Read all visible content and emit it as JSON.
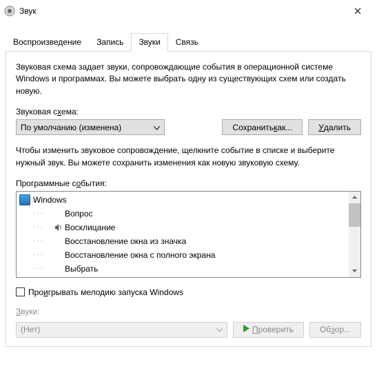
{
  "window": {
    "title": "Звук"
  },
  "tabs": [
    {
      "label": "Воспроизведение",
      "active": false
    },
    {
      "label": "Запись",
      "active": false
    },
    {
      "label": "Звуки",
      "active": true
    },
    {
      "label": "Связь",
      "active": false
    }
  ],
  "description": "Звуковая схема задает звуки, сопровождающие события в операционной системе Windows и программах. Вы можете выбрать одну из существующих схем или создать новую.",
  "scheme": {
    "label_pre": "Звуковая с",
    "label_acc": "х",
    "label_post": "ема:",
    "value": "По умолчанию (изменена)",
    "save_pre": "Сохранить ",
    "save_acc": "к",
    "save_post": "ак...",
    "delete_acc": "У",
    "delete_post": "далить"
  },
  "events_desc": "Чтобы изменить звуковое сопровождение, щелкните событие в списке и выберите нужный звук. Вы можете сохранить изменения как новую звуковую схему.",
  "events": {
    "label_pre": "Программные с",
    "label_acc": "о",
    "label_post": "бытия:",
    "root": "Windows",
    "items": [
      {
        "label": "Вопрос",
        "sound": false
      },
      {
        "label": "Восклицание",
        "sound": true
      },
      {
        "label": "Восстановление окна из значка",
        "sound": false
      },
      {
        "label": "Восстановление окна с полного экрана",
        "sound": false
      },
      {
        "label": "Выбрать",
        "sound": false
      }
    ]
  },
  "startup": {
    "pre": "Про",
    "acc": "и",
    "post": "грывать мелодию запуска Windows"
  },
  "sounds": {
    "label_acc": "З",
    "label_post": "вуки:",
    "value": "(Нет)",
    "test_acc": "П",
    "test_post": "роверить",
    "browse_pre": "Об",
    "browse_acc": "з",
    "browse_post": "ор..."
  }
}
